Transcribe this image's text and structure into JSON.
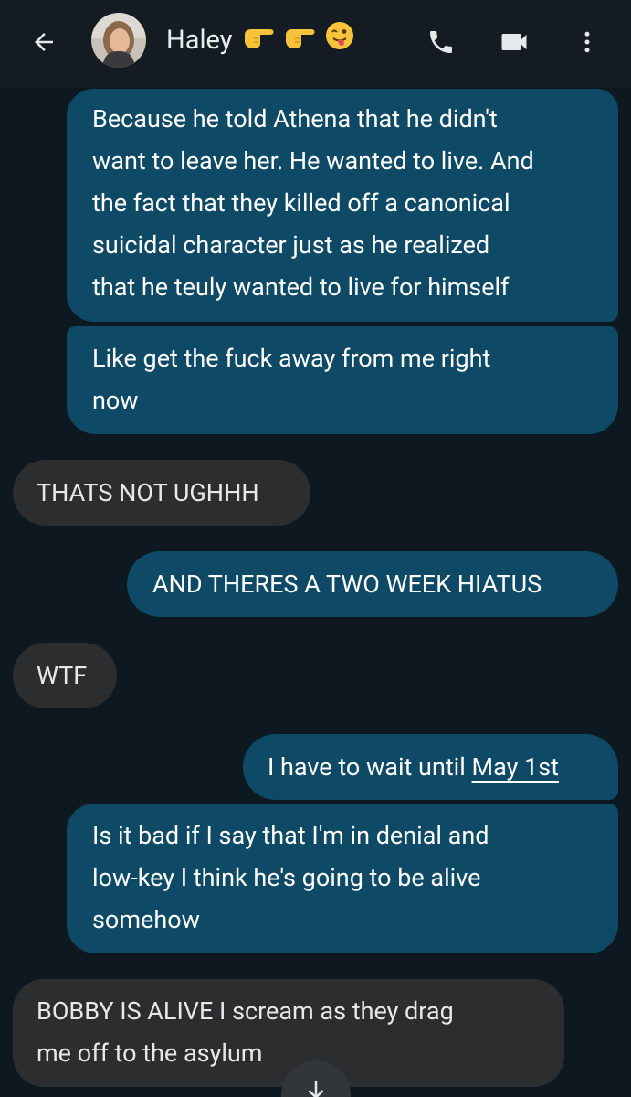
{
  "header": {
    "contact_name": "Haley",
    "emoji_icons": [
      "backhand-index-right-icon",
      "backhand-index-right-icon",
      "winking-face-tongue-icon"
    ],
    "icons": [
      "back-arrow-icon",
      "phone-icon",
      "video-camera-icon",
      "more-vert-icon"
    ]
  },
  "colors": {
    "background": "#0e1820",
    "header": "#141b22",
    "outgoing_bubble": "#0e4a65",
    "incoming_bubble": "#2c2d2f"
  },
  "messages": [
    {
      "direction": "outgoing",
      "lines": [
        "Because he told Athena that he didn't",
        "want to leave her. He wanted to live. And",
        "the fact that they killed off a canonical",
        "suicidal character just as he realized",
        "that he teuly wanted to live for himself"
      ]
    },
    {
      "direction": "outgoing",
      "lines": [
        "Like get the fuck away from me right",
        "now"
      ]
    },
    {
      "direction": "incoming",
      "lines": [
        "THATS NOT UGHHH"
      ]
    },
    {
      "direction": "outgoing",
      "lines": [
        "AND THERES A TWO WEEK HIATUS"
      ]
    },
    {
      "direction": "incoming",
      "lines": [
        "WTF"
      ]
    },
    {
      "direction": "outgoing",
      "text_before_link": "I have to wait until ",
      "link_text": "May 1st"
    },
    {
      "direction": "outgoing",
      "lines": [
        "Is it bad if I say that I'm in denial and",
        "low-key I think he's going to be alive",
        "somehow"
      ]
    },
    {
      "direction": "incoming",
      "lines": [
        "BOBBY IS ALIVE I scream as they drag",
        "me off to the asylum"
      ]
    }
  ],
  "scroll_button": {
    "icon": "arrow-down-icon"
  }
}
